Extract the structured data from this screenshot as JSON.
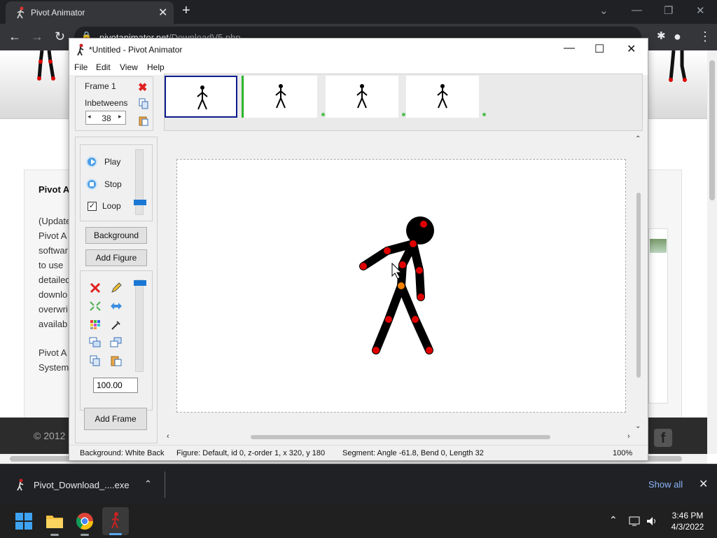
{
  "browser": {
    "tab_title": "Pivot Animator",
    "url_host": "pivotanimator.net",
    "url_path": "/DownloadV5.php"
  },
  "webpage": {
    "heading": "Pivot A",
    "para1": [
      "(Update",
      "Pivot A",
      "softwar",
      "to use",
      "detailed",
      "downlo",
      "overwri",
      "availab"
    ],
    "para2": [
      "Pivot A",
      "System"
    ],
    "footer_copy": "© 2012",
    "footer_fb": "f"
  },
  "app": {
    "title": "*Untitled - Pivot Animator",
    "menu": [
      "File",
      "Edit",
      "View",
      "Help"
    ],
    "frame_label": "Frame 1",
    "inbetweens_label": "Inbetweens",
    "inbetweens_value": "38",
    "play_label": "Play",
    "stop_label": "Stop",
    "loop_label": "Loop",
    "loop_checked": "✓",
    "background_btn": "Background",
    "add_figure_btn": "Add Figure",
    "scale_value": "100.00",
    "add_frame_btn": "Add Frame",
    "speed_level": 0.85,
    "size_level": 0.0,
    "status": {
      "background": "Background: White Back",
      "figure": "Figure: Default,  id 0,  z-order 1,  x 320, y 180",
      "segment": "Segment: Angle -61.8,  Bend 0,  Length 32",
      "zoom": "100%"
    },
    "colors": {
      "selected_frame_border": "#0b1a8a",
      "joint": "#e00000",
      "origin_joint": "#f08000",
      "slider_knob": "#1a78d4"
    }
  },
  "download_bar": {
    "file_name": "Pivot_Download_....exe",
    "show_all": "Show all"
  },
  "taskbar": {
    "time": "3:46 PM",
    "date": "4/3/2022",
    "icons": [
      "windows-start-icon",
      "file-explorer-icon",
      "chrome-icon",
      "pivot-animator-icon"
    ]
  }
}
